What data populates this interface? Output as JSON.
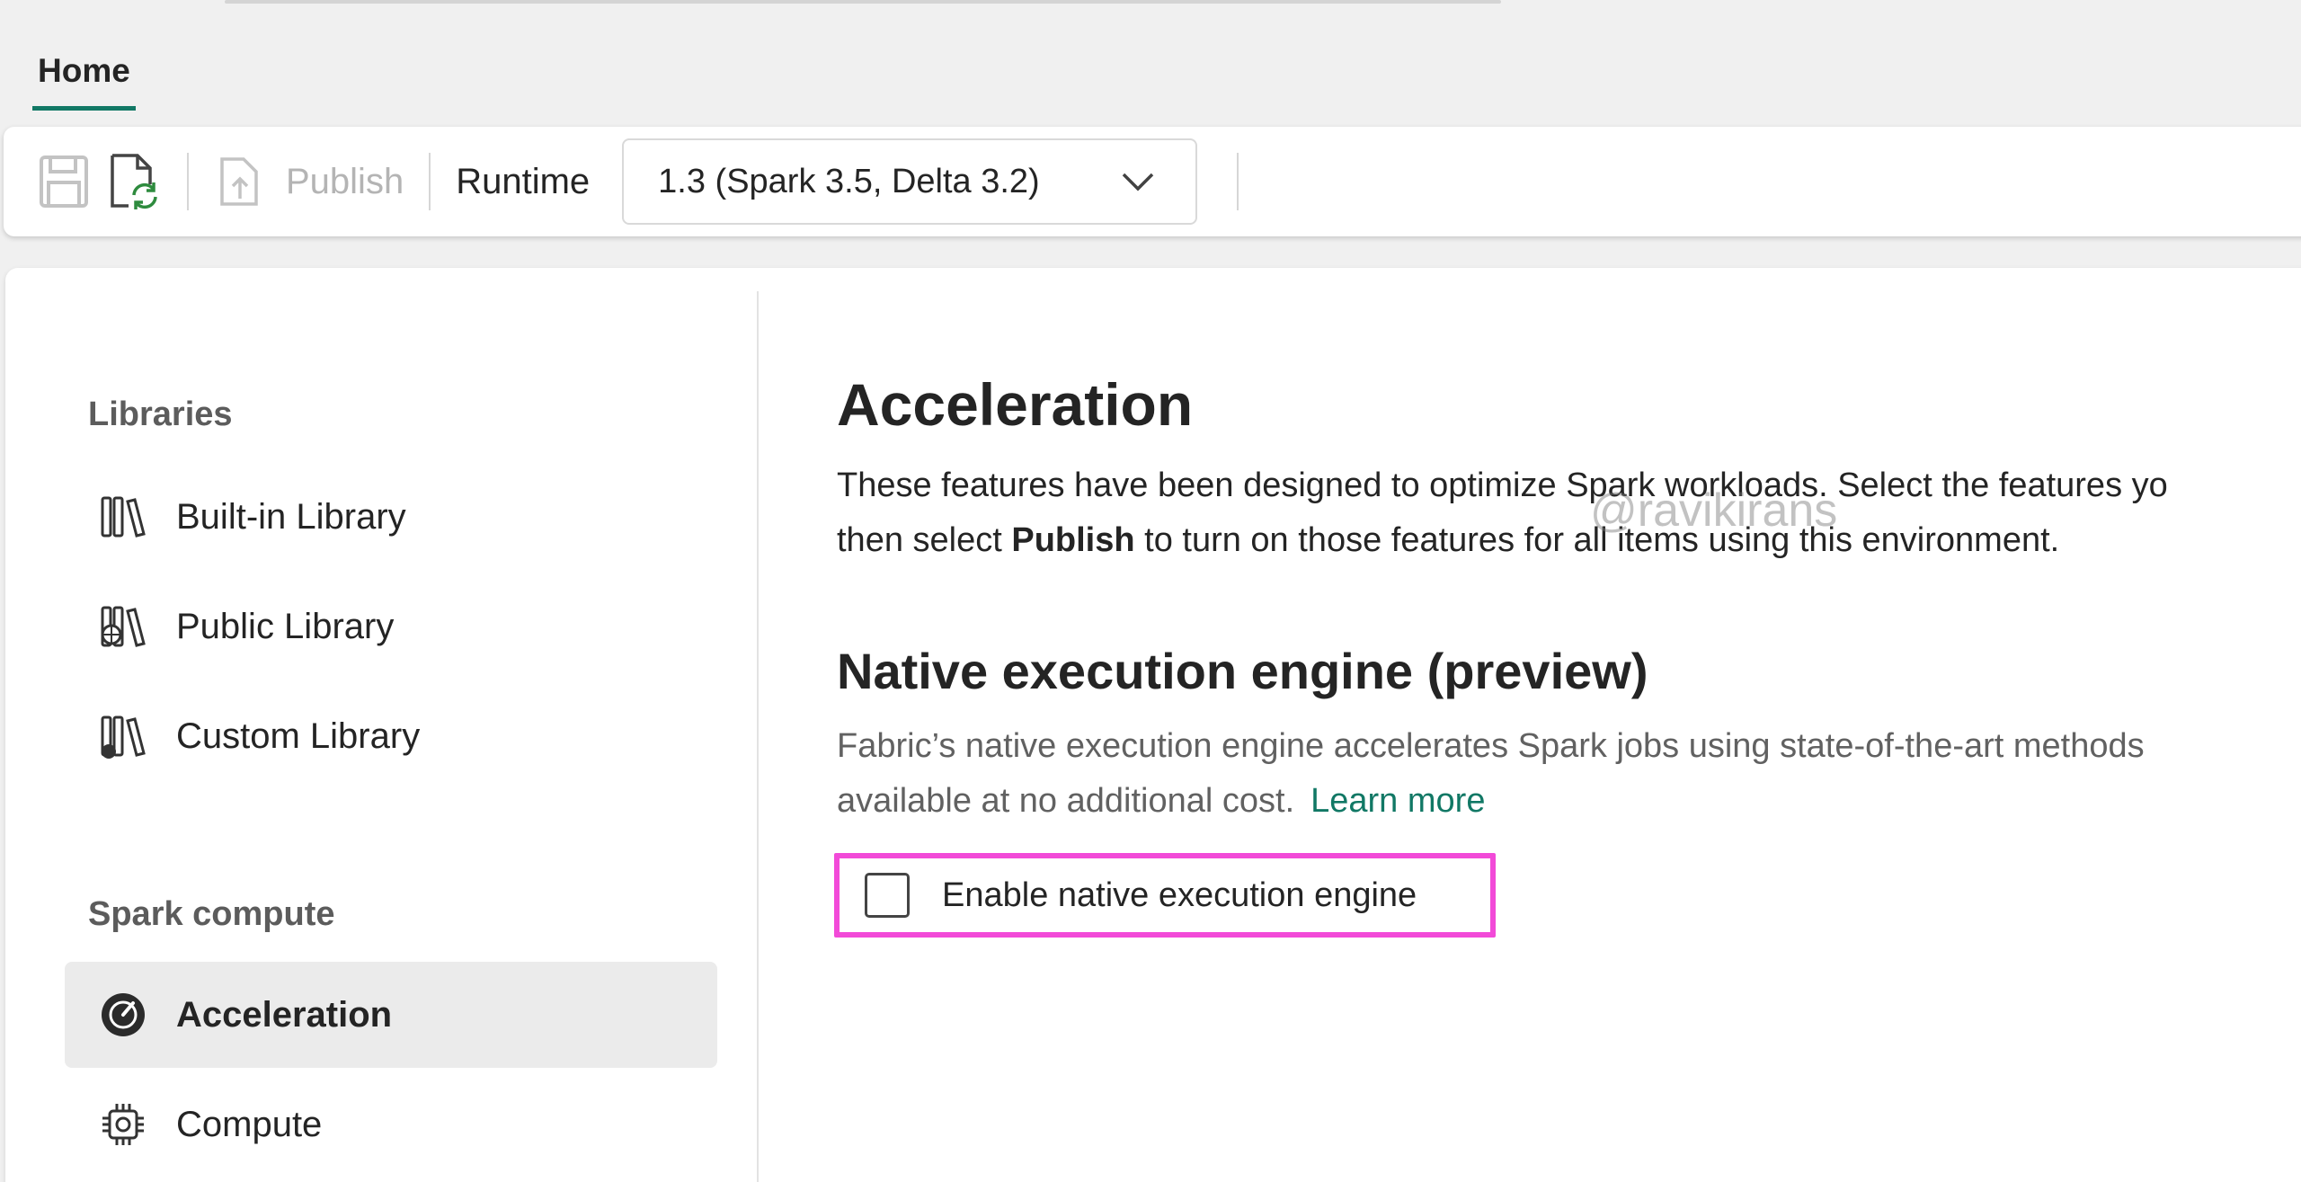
{
  "tabs": {
    "home": "Home"
  },
  "toolbar": {
    "save_icon": "save-icon",
    "refresh_icon": "refresh-document-icon",
    "publish_label": "Publish",
    "runtime_label": "Runtime",
    "runtime_value": "1.3 (Spark 3.5, Delta 3.2)"
  },
  "sidebar": {
    "libraries_heading": "Libraries",
    "items": [
      {
        "label": "Built-in Library",
        "icon": "built-in-library-icon"
      },
      {
        "label": "Public Library",
        "icon": "public-library-icon"
      },
      {
        "label": "Custom Library",
        "icon": "custom-library-icon"
      }
    ],
    "spark_heading": "Spark compute",
    "compute_items": [
      {
        "label": "Acceleration",
        "icon": "gauge-icon",
        "active": true
      },
      {
        "label": "Compute",
        "icon": "chip-icon",
        "active": false
      }
    ]
  },
  "main": {
    "title": "Acceleration",
    "desc_line1": "These features have been designed to optimize Spark workloads. Select the features yo",
    "desc_line2_pre": "then select ",
    "desc_line2_bold": "Publish",
    "desc_line2_post": " to turn on those features for all items using this environment.",
    "watermark": "@ravikirans",
    "section_title": "Native execution engine (preview)",
    "section_desc_line1": "Fabric’s native execution engine accelerates Spark jobs using state-of-the-art methods",
    "section_desc_line2": "available at no additional cost.",
    "learn_more": "Learn more",
    "checkbox_label": "Enable native execution engine",
    "checkbox_checked": false
  },
  "colors": {
    "accent": "#117865",
    "highlight": "#f24ad8",
    "disabled_text": "#b4b4b4"
  }
}
